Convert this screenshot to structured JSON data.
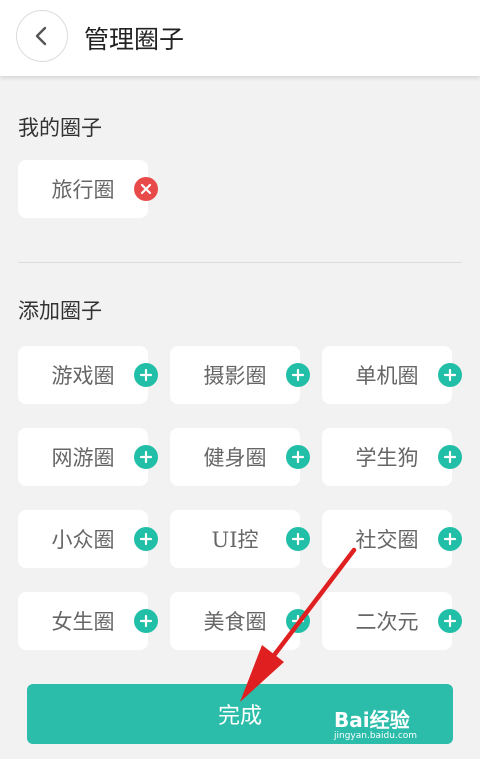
{
  "header": {
    "title": "管理圈子"
  },
  "my_circles": {
    "title": "我的圈子",
    "items": [
      {
        "label": "旅行圈",
        "action": "remove-icon"
      }
    ]
  },
  "add_circles": {
    "title": "添加圈子",
    "items": [
      {
        "label": "游戏圈"
      },
      {
        "label": "摄影圈"
      },
      {
        "label": "单机圈"
      },
      {
        "label": "网游圈"
      },
      {
        "label": "健身圈"
      },
      {
        "label": "学生狗"
      },
      {
        "label": "小众圈"
      },
      {
        "label": "UI控"
      },
      {
        "label": "社交圈"
      },
      {
        "label": "女生圈"
      },
      {
        "label": "美食圈"
      },
      {
        "label": "二次元"
      }
    ]
  },
  "done_button": {
    "label": "完成"
  },
  "watermark": {
    "brand": "Bai经验",
    "url": "jingyan.baidu.com"
  },
  "colors": {
    "accent": "#2bbcaa",
    "add": "#21bfa7",
    "remove": "#e84a4a",
    "arrow": "#e02020"
  }
}
